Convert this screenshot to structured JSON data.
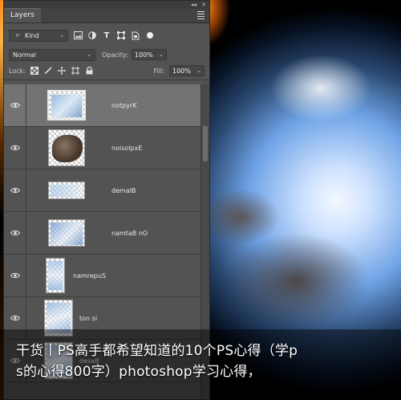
{
  "panel": {
    "tab_label": "Layers",
    "top_controls": [
      "◂◂",
      "✕"
    ],
    "filter": {
      "kind_label": "Kind",
      "icons": [
        "image-filter-icon",
        "adjustment-filter-icon",
        "type-filter-icon",
        "shape-filter-icon",
        "smart-object-filter-icon"
      ]
    },
    "blend_mode": "Normal",
    "opacity": {
      "label": "Opacity:",
      "value": "100%"
    },
    "lock": {
      "label": "Lock:",
      "icons": [
        "lock-transparent-icon",
        "lock-image-icon",
        "lock-position-icon",
        "lock-artboard-icon",
        "lock-all-icon"
      ]
    },
    "fill": {
      "label": "Fill:",
      "value": "100%"
    }
  },
  "layers": [
    {
      "name": "notpyrK",
      "selected": true
    },
    {
      "name": "noisolpxE",
      "selected": false
    },
    {
      "name": "demalB",
      "selected": false
    },
    {
      "name": "namtaB nO",
      "selected": false
    },
    {
      "name": "namrepuS",
      "selected": false
    },
    {
      "name": "ton si",
      "selected": false
    },
    {
      "name": "desaB",
      "selected": false
    }
  ],
  "caption": {
    "line1": "干货丨PS高手都希望知道的10个PS心得（学p",
    "line2": "s的心得800字）photoshop学习心得，"
  },
  "colors": {
    "panel_bg": "#535353",
    "selected_row": "#737373",
    "planet_glow": "#cfe3ff",
    "fire": "#ff8a1a"
  }
}
